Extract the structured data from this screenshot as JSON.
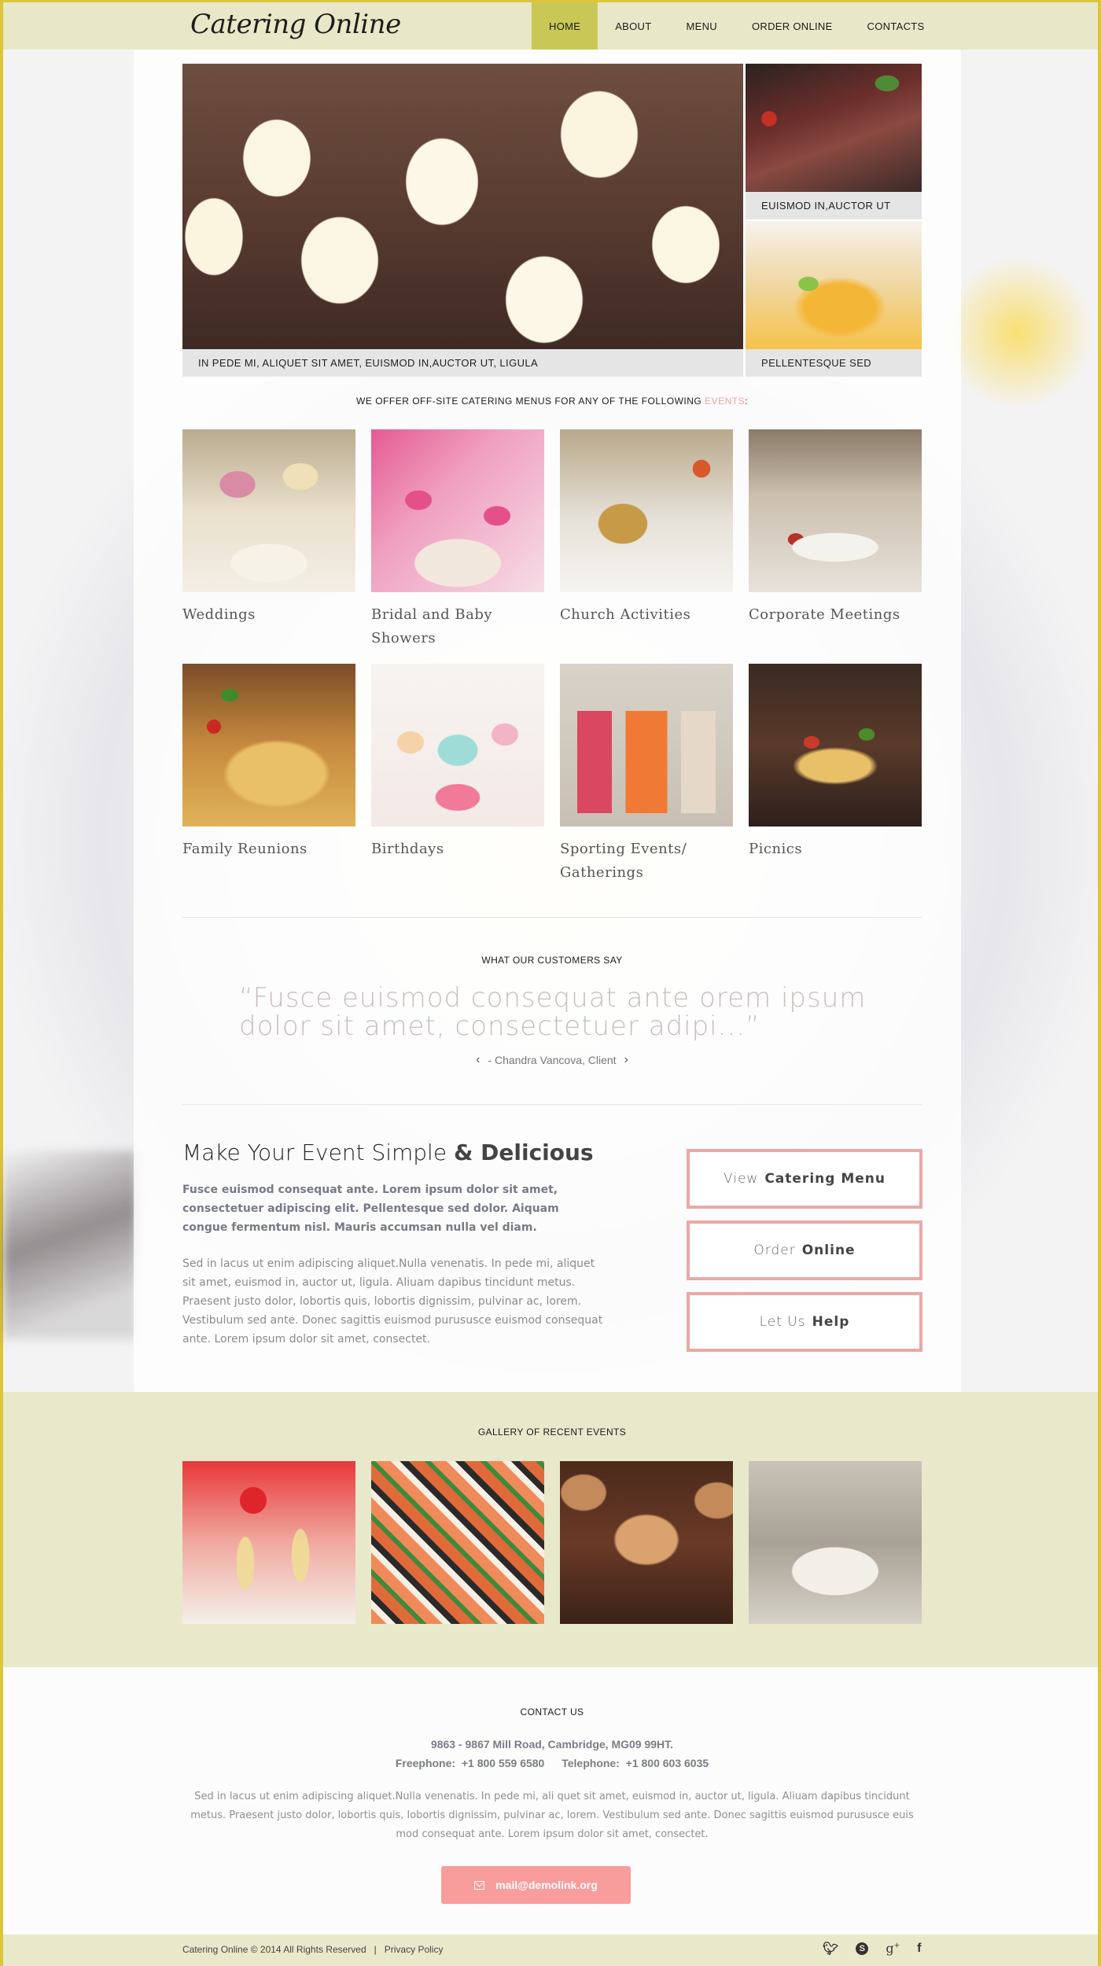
{
  "header": {
    "logo": "Catering Online",
    "nav": [
      {
        "label": "HOME",
        "active": true
      },
      {
        "label": "ABOUT",
        "active": false
      },
      {
        "label": "MENU",
        "active": false
      },
      {
        "label": "ORDER ONLINE",
        "active": false
      },
      {
        "label": "CONTACTS",
        "active": false
      }
    ]
  },
  "hero": {
    "main_caption": "IN PEDE MI, ALIQUET SIT AMET, EUISMOD IN,AUCTOR UT, LIGULA",
    "side_top_caption": "EUISMOD IN,AUCTOR UT",
    "side_bottom_caption": "PELLENTESQUE SED",
    "images": {
      "main": "cupcakes-photo",
      "side_top": "steak-photo",
      "side_bottom": "dessert-photo"
    }
  },
  "events": {
    "heading_prefix": "WE OFFER OFF-SITE CATERING MENUS FOR ANY OF THE FOLLOWING ",
    "heading_accent": "EVENTS",
    "heading_suffix": ":",
    "accent_color": "#e8a49f",
    "items": [
      {
        "label": "Weddings",
        "image": "wedding-cake-photo"
      },
      {
        "label": "Bridal and Baby Showers",
        "image": "pink-cupcakes-photo"
      },
      {
        "label": "Church Activities",
        "image": "appetizer-photo"
      },
      {
        "label": "Corporate Meetings",
        "image": "banquet-table-photo"
      },
      {
        "label": "Family Reunions",
        "image": "pizza-photo"
      },
      {
        "label": "Birthdays",
        "image": "cupcakes-pastel-photo"
      },
      {
        "label": "Sporting Events/ Gatherings",
        "image": "smoothies-photo"
      },
      {
        "label": "Picnics",
        "image": "tacos-photo"
      }
    ]
  },
  "testimonials": {
    "heading": "WHAT OUR CUSTOMERS SAY",
    "quote": "“Fusce euismod consequat ante orem ipsum dolor sit amet, consectetuer adipi...”",
    "author": "- Chandra Vancova, Client",
    "prev_icon": "chevron-left",
    "next_icon": "chevron-right"
  },
  "promo": {
    "title_light": "Make Your Event Simple ",
    "title_bold": "& Delicious",
    "lead": "Fusce euismod consequat ante. Lorem ipsum dolor sit amet, consectetuer adipiscing elit. Pellentesque sed dolor. Aiquam congue fermentum nisl. Mauris accumsan nulla vel diam.",
    "body": "Sed in lacus ut enim adipiscing aliquet.Nulla venenatis. In pede mi, aliquet sit amet, euismod in, auctor ut, ligula. Aliuam dapibus tincidunt metus. Praesent justo dolor, lobortis quis, lobortis dignissim, pulvinar ac, lorem. Vestibulum sed ante. Donec sagittis euismod purususce euismod consequat ante. Lorem ipsum dolor sit amet, consectet.",
    "buttons": [
      {
        "light": "View",
        "bold": "Catering Menu"
      },
      {
        "light": "Order",
        "bold": "Online"
      },
      {
        "light": "Let Us",
        "bold": "Help"
      }
    ],
    "button_border_color": "#eaa8a6"
  },
  "gallery": {
    "heading": "GALLERY OF RECENT EVENTS",
    "items": [
      {
        "image": "champagne-glasses-photo"
      },
      {
        "image": "sushi-platter-photo"
      },
      {
        "image": "chocolate-cupcakes-photo"
      },
      {
        "image": "plated-dish-photo"
      }
    ],
    "background_color": "#e8e9cb"
  },
  "contact": {
    "heading": "CONTACT US",
    "address": "9863 - 9867 Mill Road,  Cambridge, MG09 99HT.",
    "freephone_label": "Freephone:",
    "freephone": "+1 800 559 6580",
    "telephone_label": "Telephone:",
    "telephone": "+1 800 603 6035",
    "text": "Sed in lacus ut enim adipiscing aliquet.Nulla venenatis. In pede mi, ali quet sit amet, euismod in, auctor ut, ligula. Aliuam dapibus tincidunt metus. Praesent justo dolor, lobortis quis, lobortis dignissim, pulvinar ac, lorem. Vestibulum sed ante. Donec sagittis euismod purususce euis mod consequat ante. Lorem ipsum dolor sit amet, consectet.",
    "email": "mail@demolink.org",
    "email_button_color": "#f99c9c"
  },
  "footer": {
    "copyright": "Catering Online © 2014 All Rights Reserved",
    "separator": "|",
    "privacy": "Privacy Policy",
    "social": [
      {
        "name": "twitter",
        "glyph": "𝕂"
      },
      {
        "name": "skype",
        "glyph": "S"
      },
      {
        "name": "google-plus",
        "glyph": "g+"
      },
      {
        "name": "facebook",
        "glyph": "f"
      }
    ]
  },
  "theme": {
    "header_bg": "#e8e8c8",
    "nav_active_bg": "#c9c856",
    "frame_color": "#dcc53a"
  }
}
